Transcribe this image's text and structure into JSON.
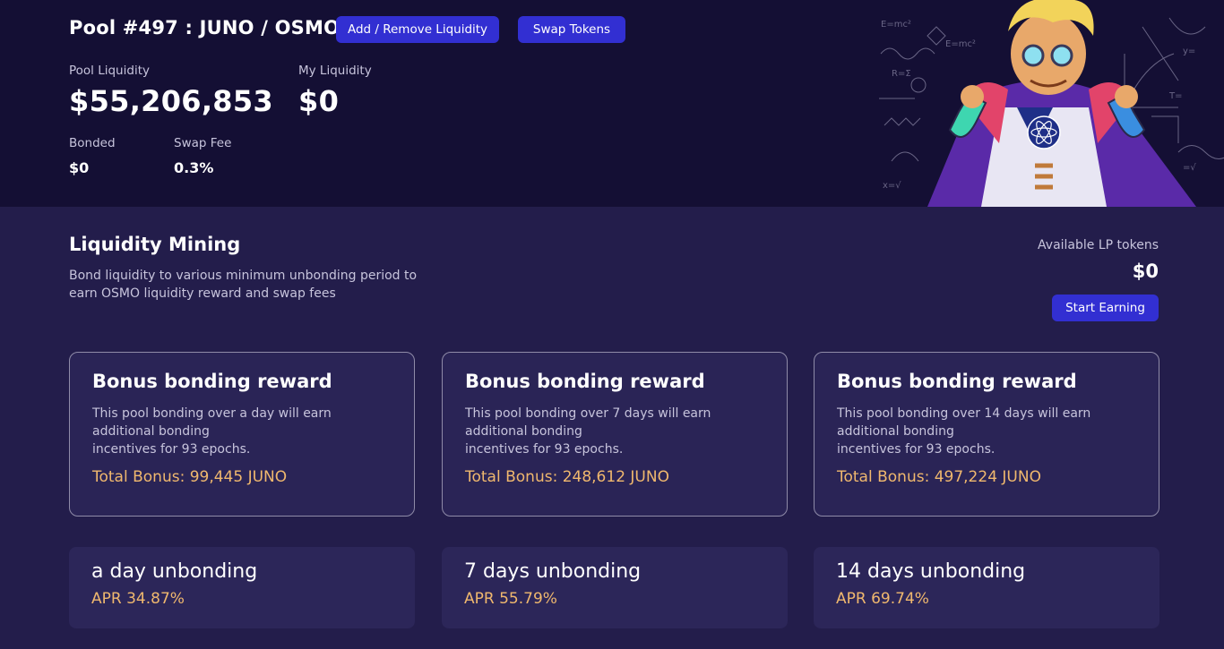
{
  "pool": {
    "title": "Pool #497 : JUNO / OSMO",
    "add_remove_label": "Add / Remove Liquidity",
    "swap_label": "Swap Tokens",
    "pool_liquidity_label": "Pool Liquidity",
    "pool_liquidity_value": "$55,206,853",
    "my_liquidity_label": "My Liquidity",
    "my_liquidity_value": "$0",
    "bonded_label": "Bonded",
    "bonded_value": "$0",
    "swap_fee_label": "Swap Fee",
    "swap_fee_value": "0.3%"
  },
  "mining": {
    "title": "Liquidity Mining",
    "description": "Bond liquidity to various minimum unbonding period to earn OSMO liquidity reward and swap fees",
    "available_label": "Available LP tokens",
    "available_value": "$0",
    "start_label": "Start Earning"
  },
  "bonus_cards": [
    {
      "title": "Bonus bonding reward",
      "desc_line1": "This pool bonding over a day will earn additional bonding",
      "desc_line2": "incentives for 93 epochs.",
      "total": "Total Bonus: 99,445 JUNO"
    },
    {
      "title": "Bonus bonding reward",
      "desc_line1": "This pool bonding over 7 days will earn additional bonding",
      "desc_line2": "incentives for 93 epochs.",
      "total": "Total Bonus: 248,612 JUNO"
    },
    {
      "title": "Bonus bonding reward",
      "desc_line1": "This pool bonding over 14 days will earn additional bonding",
      "desc_line2": "incentives for 93 epochs.",
      "total": "Total Bonus: 497,224 JUNO"
    }
  ],
  "unbond_cards": [
    {
      "title": "a day unbonding",
      "apr": "APR 34.87%"
    },
    {
      "title": "7 days unbonding",
      "apr": "APR 55.79%"
    },
    {
      "title": "14 days unbonding",
      "apr": "APR 69.74%"
    }
  ],
  "colors": {
    "accent": "#322fd2",
    "highlight": "#f0b86e",
    "header_bg": "#140f34",
    "page_bg": "#231d4b"
  }
}
